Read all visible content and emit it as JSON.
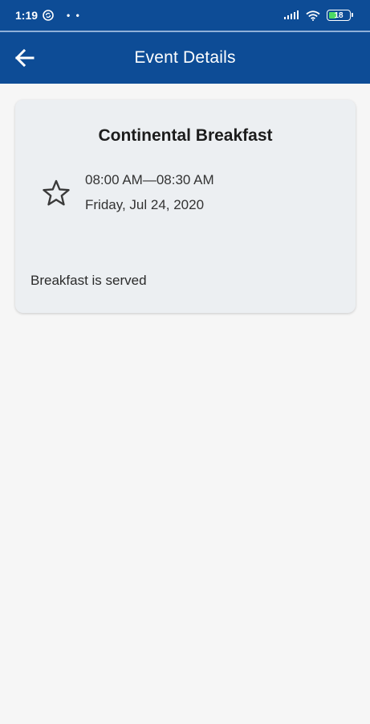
{
  "status_bar": {
    "time": "1:19",
    "dots": "• •",
    "battery_level": "18"
  },
  "app_bar": {
    "title": "Event Details",
    "back_icon": "arrow-left-icon"
  },
  "event": {
    "title": "Continental Breakfast",
    "time_range": "08:00 AM—08:30 AM",
    "date": "Friday, Jul 24, 2020",
    "description": "Breakfast is served",
    "favorite_icon": "star-outline-icon"
  },
  "colors": {
    "primary": "#0d4c96",
    "background": "#f6f6f6",
    "card": "#eceff2",
    "battery": "#4cd964"
  }
}
